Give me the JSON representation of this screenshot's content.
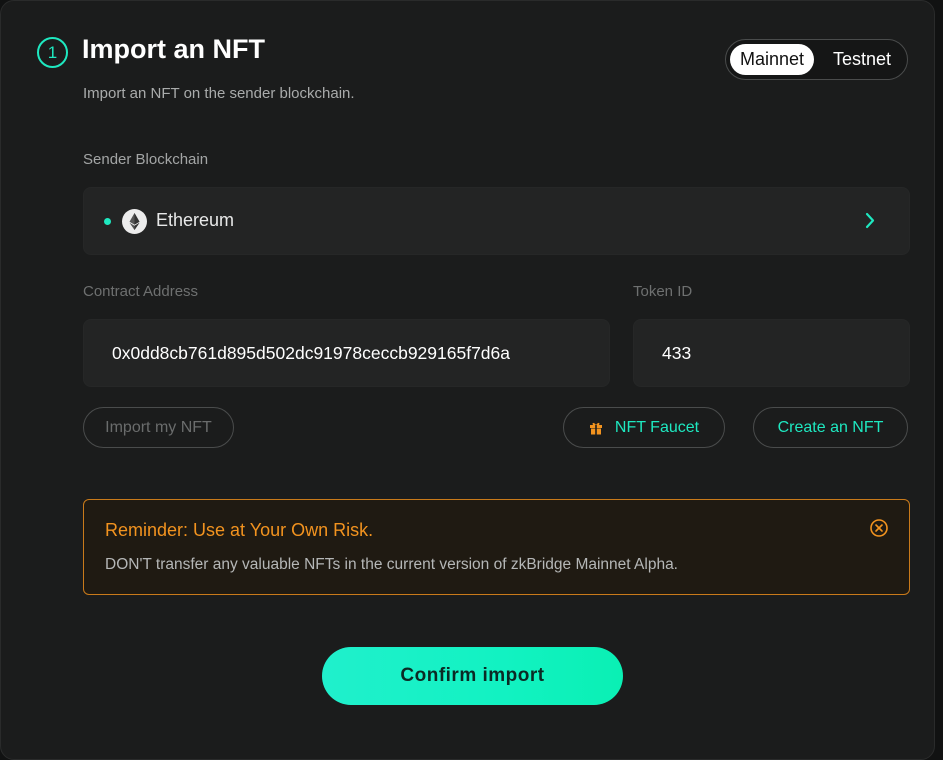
{
  "header": {
    "step_number": "1",
    "title": "Import an NFT",
    "subtitle": "Import an NFT on the sender blockchain."
  },
  "network_toggle": {
    "options": [
      "Mainnet",
      "Testnet"
    ],
    "selected": "Mainnet"
  },
  "sender": {
    "label": "Sender Blockchain",
    "chain_name": "Ethereum",
    "chain_icon": "ethereum-icon",
    "status_color": "#1ee8c0"
  },
  "contract": {
    "label": "Contract Address",
    "value": "0x0dd8cb761d895d502dc91978ceccb929165f7d6a"
  },
  "token": {
    "label": "Token ID",
    "value": "433"
  },
  "actions": {
    "import_my_nft": "Import my NFT",
    "nft_faucet": "NFT Faucet",
    "create_nft": "Create an NFT"
  },
  "reminder": {
    "title": "Reminder: Use at Your Own Risk.",
    "text": "DON'T transfer any valuable NFTs in the current version of zkBridge Mainnet Alpha."
  },
  "confirm_label": "Confirm import",
  "colors": {
    "accent": "#1ee8c0",
    "warning": "#f2931f",
    "background": "#1b1c1c"
  }
}
